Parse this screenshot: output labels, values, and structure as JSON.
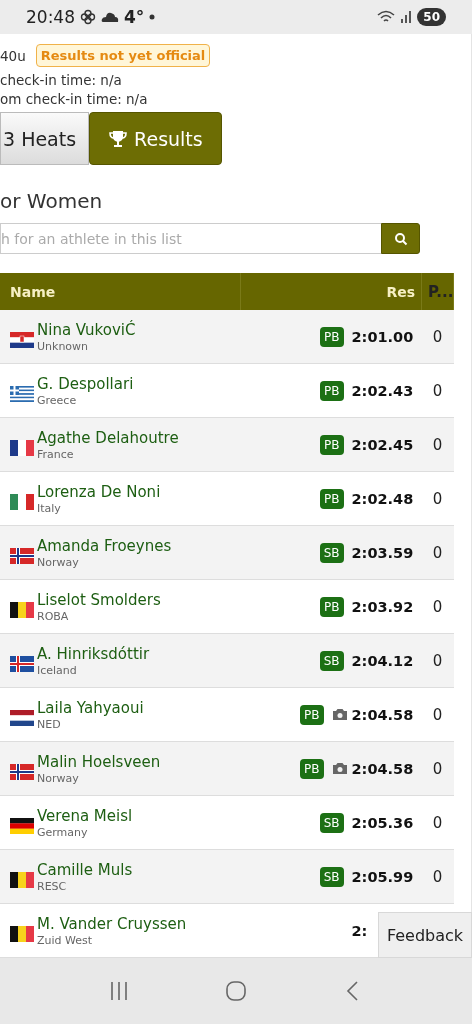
{
  "status_bar": {
    "time": "20:48",
    "temperature": "4°",
    "battery": "50"
  },
  "event_info": {
    "category": "40u",
    "status_badge": "Results not yet official",
    "lines": [
      "check-in time: n/a",
      "om check-in time: n/a"
    ]
  },
  "tabs": [
    {
      "label": "3 Heats",
      "selected": false,
      "kind": "heats"
    },
    {
      "label": "Results",
      "selected": true,
      "kind": "results"
    }
  ],
  "heading": "or Women",
  "search": {
    "placeholder": "h for an athlete in this list"
  },
  "table": {
    "columns": [
      "Name",
      "Res",
      "P..."
    ],
    "rows": [
      {
        "name": "Nina VukoviĆ",
        "club": "Unknown",
        "kind": "hr",
        "badge": "PB",
        "photo": false,
        "result": "2:01.00",
        "place": "0"
      },
      {
        "name": "G. Despollari",
        "club": "Greece",
        "kind": "gr",
        "badge": "PB",
        "photo": false,
        "result": "2:02.43",
        "place": "0"
      },
      {
        "name": "Agathe Delahoutre",
        "club": "France",
        "kind": "fr",
        "badge": "PB",
        "photo": false,
        "result": "2:02.45",
        "place": "0"
      },
      {
        "name": "Lorenza De Noni",
        "club": "Italy",
        "kind": "it",
        "badge": "PB",
        "photo": false,
        "result": "2:02.48",
        "place": "0"
      },
      {
        "name": "Amanda Froeynes",
        "club": "Norway",
        "kind": "no",
        "badge": "SB",
        "photo": false,
        "result": "2:03.59",
        "place": "0"
      },
      {
        "name": "Liselot Smolders",
        "club": "ROBA",
        "kind": "be",
        "badge": "PB",
        "photo": false,
        "result": "2:03.92",
        "place": "0"
      },
      {
        "name": "A. Hinriksdóttir",
        "club": "Iceland",
        "kind": "is",
        "badge": "SB",
        "photo": false,
        "result": "2:04.12",
        "place": "0"
      },
      {
        "name": "Laila Yahyaoui",
        "club": "NED",
        "kind": "nl",
        "badge": "PB",
        "photo": true,
        "result": "2:04.58",
        "place": "0"
      },
      {
        "name": "Malin Hoelsveen",
        "club": "Norway",
        "kind": "no",
        "badge": "PB",
        "photo": true,
        "result": "2:04.58",
        "place": "0"
      },
      {
        "name": "Verena Meisl",
        "club": "Germany",
        "kind": "de",
        "badge": "SB",
        "photo": false,
        "result": "2:05.36",
        "place": "0"
      },
      {
        "name": "Camille Muls",
        "club": "RESC",
        "kind": "be",
        "badge": "SB",
        "photo": false,
        "result": "2:05.99",
        "place": "0"
      },
      {
        "name": "M. Vander Cruyssen",
        "club": "Zuid West",
        "kind": "be",
        "photo": false,
        "result": "2:"
      }
    ]
  },
  "feedback_button": "Feedback"
}
